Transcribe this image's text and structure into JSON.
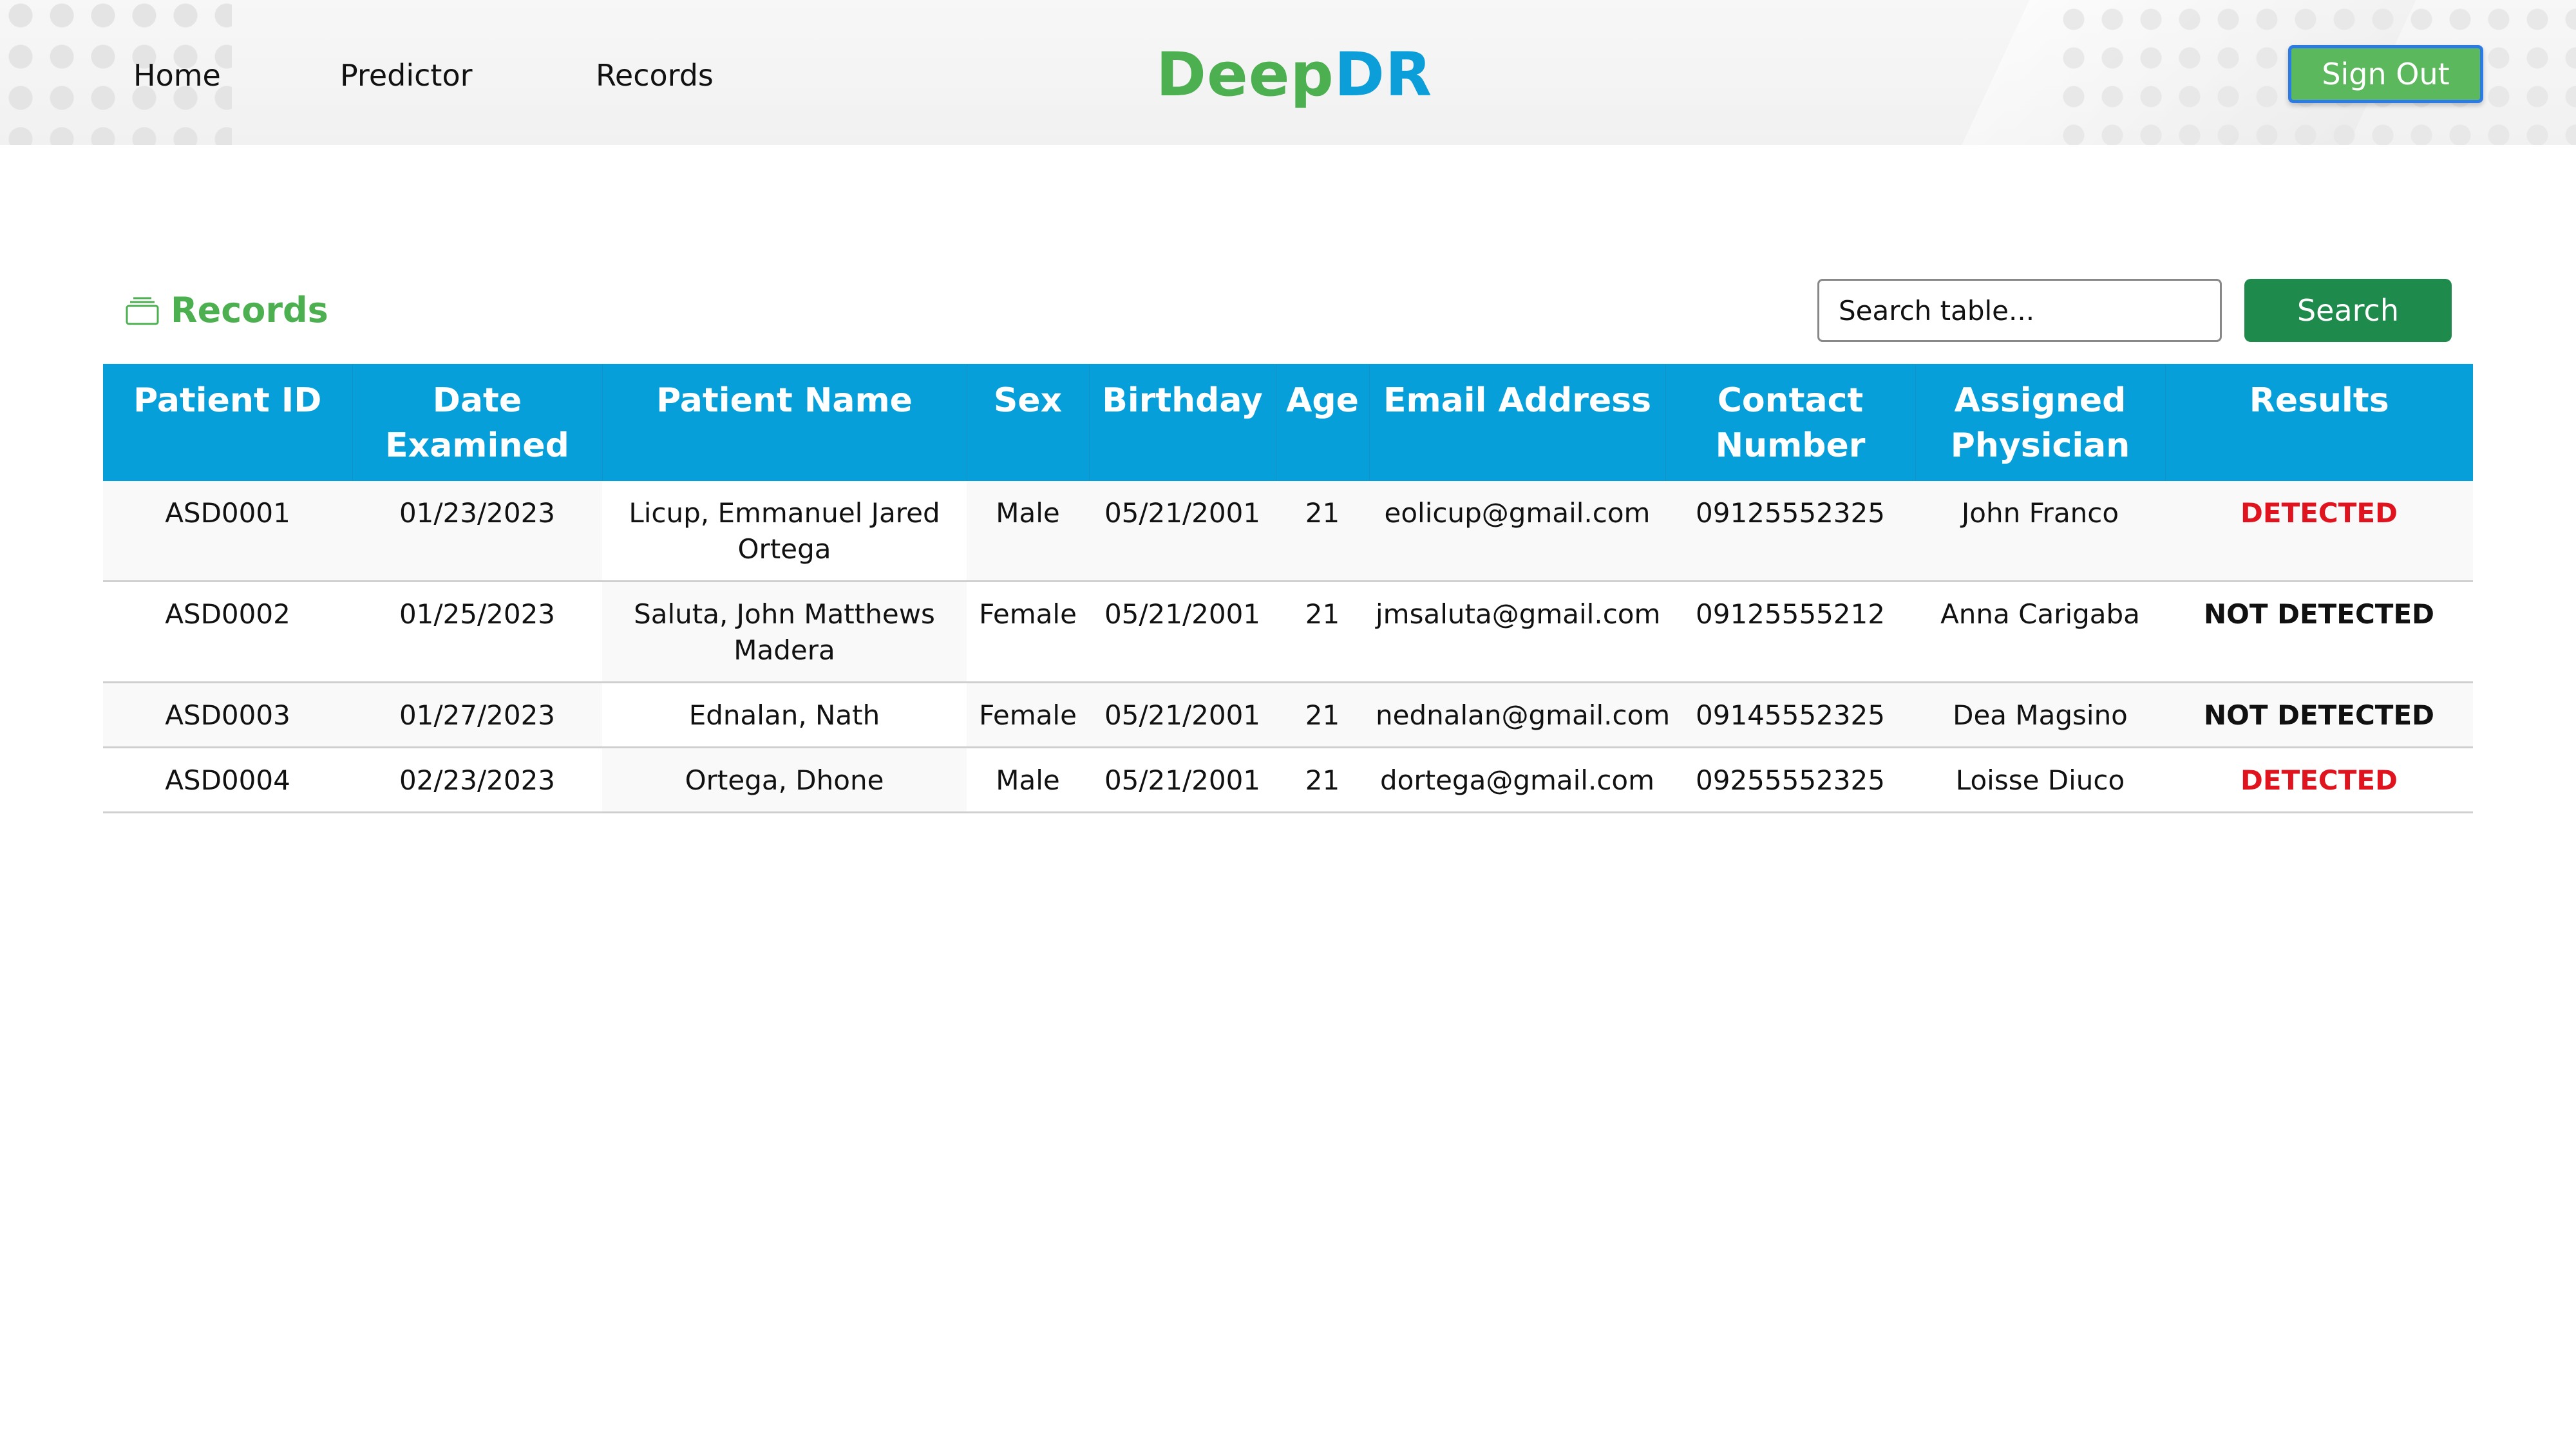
{
  "nav": {
    "home": "Home",
    "predictor": "Predictor",
    "records": "Records"
  },
  "logo": {
    "part1": "Deep",
    "part2": "DR"
  },
  "account": {
    "signout_label": "Sign Out"
  },
  "section": {
    "title": "Records",
    "icon": "records-stack-icon"
  },
  "search": {
    "placeholder": "Search table...",
    "button_label": "Search"
  },
  "table": {
    "headers": [
      "Patient ID",
      "Date Examined",
      "Patient Name",
      "Sex",
      "Birthday",
      "Age",
      "Email Address",
      "Contact Number",
      "Assigned Physician",
      "Results"
    ],
    "rows": [
      [
        "ASD0001",
        "01/23/2023",
        "Licup, Emmanuel Jared Ortega",
        "Male",
        "05/21/2001",
        "21",
        "eolicup@gmail.com",
        "09125552325",
        "John Franco",
        "DETECTED"
      ],
      [
        "ASD0002",
        "01/25/2023",
        "Saluta, John Matthews Madera",
        "Female",
        "05/21/2001",
        "21",
        "jmsaluta@gmail.com",
        "09125555212",
        "Anna Carigaba",
        "NOT DETECTED"
      ],
      [
        "ASD0003",
        "01/27/2023",
        "Ednalan, Nath",
        "Female",
        "05/21/2001",
        "21",
        "nednalan@gmail.com",
        "09145552325",
        "Dea Magsino",
        "NOT DETECTED"
      ],
      [
        "ASD0004",
        "02/23/2023",
        "Ortega, Dhone",
        "Male",
        "05/21/2001",
        "21",
        "dortega@gmail.com",
        "09255552325",
        "Loisse Diuco",
        "DETECTED"
      ]
    ]
  },
  "colors": {
    "header_blue": "#069fd9",
    "logo_green": "#4caf50",
    "logo_blue": "#0c9ed8",
    "search_green": "#1e8a4c",
    "detected_red": "#e0141e"
  }
}
